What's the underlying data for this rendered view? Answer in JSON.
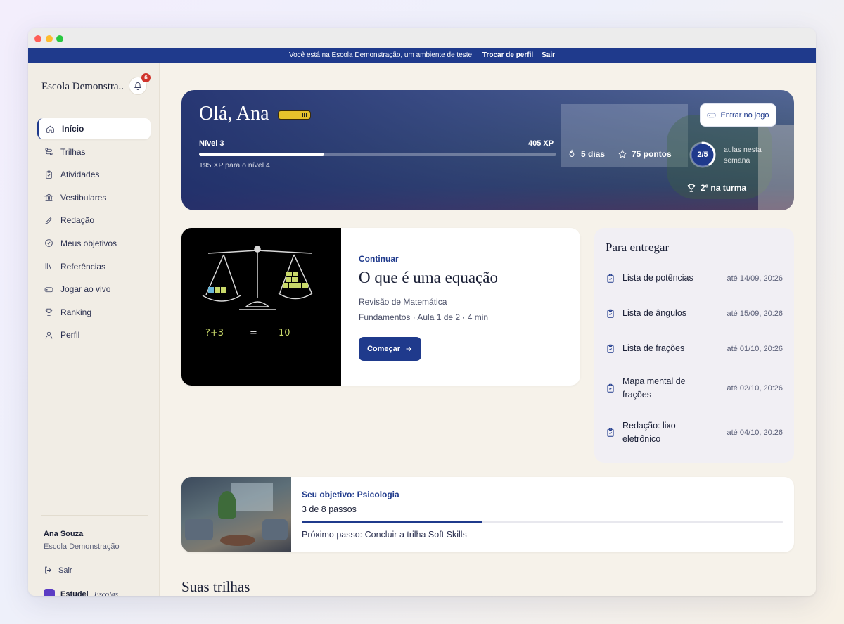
{
  "banner": {
    "message": "Você está na Escola Demonstração, um ambiente de teste.",
    "switch_profile": "Trocar de perfil",
    "logout": "Sair"
  },
  "sidebar": {
    "school_name": "Escola Demonstra...",
    "notification_count": "6",
    "items": [
      {
        "label": "Início",
        "icon": "home-icon",
        "active": true
      },
      {
        "label": "Trilhas",
        "icon": "route-icon"
      },
      {
        "label": "Atividades",
        "icon": "clipboard-icon"
      },
      {
        "label": "Vestibulares",
        "icon": "institution-icon"
      },
      {
        "label": "Redação",
        "icon": "pen-icon"
      },
      {
        "label": "Meus objetivos",
        "icon": "target-icon"
      },
      {
        "label": "Referências",
        "icon": "library-icon"
      },
      {
        "label": "Jogar ao vivo",
        "icon": "gamepad-icon"
      },
      {
        "label": "Ranking",
        "icon": "trophy-icon"
      },
      {
        "label": "Perfil",
        "icon": "user-icon"
      }
    ],
    "user_name": "Ana Souza",
    "user_school": "Escola Demonstração",
    "logout": "Sair",
    "brand_name": "Estudei",
    "brand_suffix": "Escolas"
  },
  "hero": {
    "greeting": "Olá, Ana",
    "level": "Nível 3",
    "xp": "405 XP",
    "xp_progress": 0.35,
    "xp_next": "195 XP para o nível 4",
    "streak": "5 dias",
    "points": "75 pontos",
    "weekly_lessons": "2/5",
    "weekly_progress": 0.4,
    "weekly_label": "aulas nesta semana",
    "rank": "2º na turma",
    "game_button": "Entrar no jogo"
  },
  "lesson": {
    "kicker": "Continuar",
    "title": "O que é uma equação",
    "subtitle": "Revisão de Matemática",
    "meta": "Fundamentos · Aula 1 de 2 · 4 min",
    "button": "Começar",
    "board_text_left": "?+3",
    "board_text_eq": "=",
    "board_text_right": "10"
  },
  "due": {
    "title": "Para entregar",
    "items": [
      {
        "name": "Lista de potências",
        "date": "até 14/09, 20:26"
      },
      {
        "name": "Lista de ângulos",
        "date": "até 15/09, 20:26"
      },
      {
        "name": "Lista de frações",
        "date": "até 01/10, 20:26"
      },
      {
        "name": "Mapa mental de frações",
        "date": "até 02/10, 20:26"
      },
      {
        "name": "Redação: lixo eletrônico",
        "date": "até 04/10, 20:26"
      }
    ]
  },
  "goal": {
    "kicker": "Seu objetivo: Psicologia",
    "steps": "3 de 8 passos",
    "progress": 0.375,
    "next": "Próximo passo: Concluir a trilha Soft Skills"
  },
  "tracks": {
    "title": "Suas trilhas"
  },
  "colors": {
    "primary": "#1f3a8c",
    "background": "#f6f2ea",
    "badge": "#d0342c"
  }
}
